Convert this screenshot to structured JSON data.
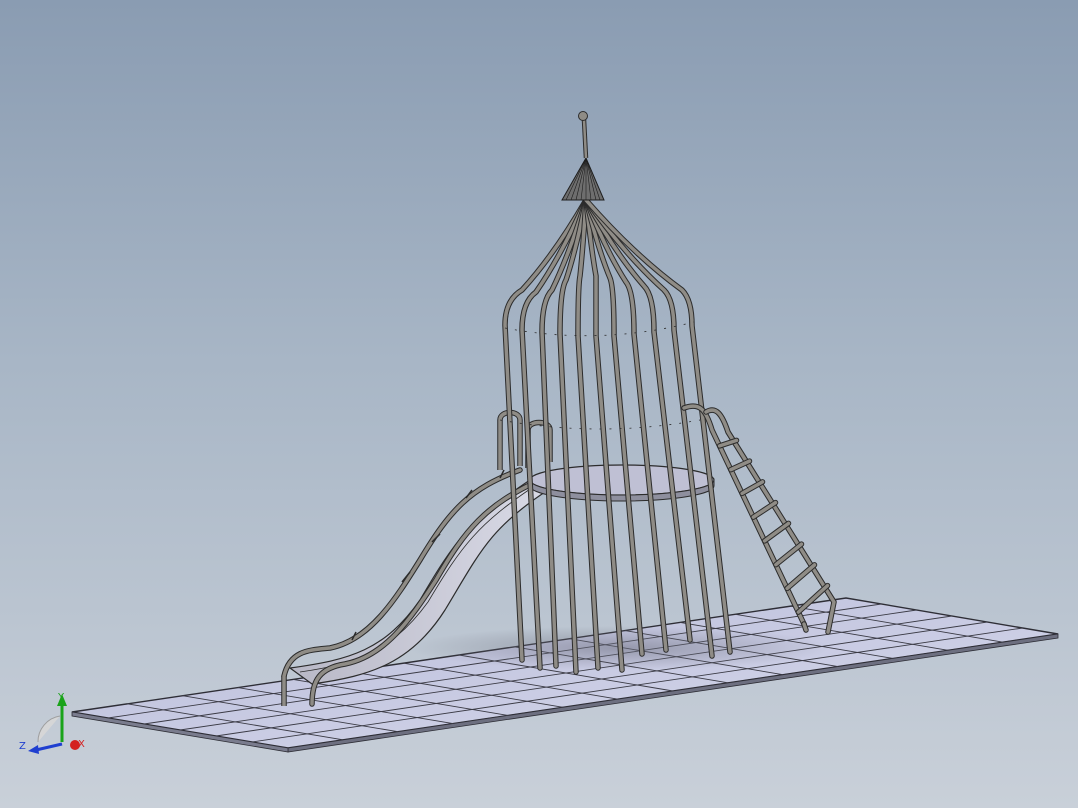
{
  "viewport": {
    "background_top": "#8a9cb2",
    "background_bottom": "#c9d0d9"
  },
  "model": {
    "components": [
      "ground-grid",
      "rocket-cage",
      "nose-cone",
      "antenna",
      "platform",
      "slide",
      "ladder"
    ],
    "colors": {
      "tube": "#8f8c86",
      "tube_outline": "#2c2c2c",
      "grid_fill": "#c8cbe3",
      "grid_line": "#3a3a44",
      "cone": "#6e6e6e"
    }
  },
  "triad": {
    "x_label": "X",
    "y_label": "Y",
    "z_label": "Z",
    "x_color": "#d42020",
    "y_color": "#1aa31a",
    "z_color": "#1f3fd0"
  }
}
